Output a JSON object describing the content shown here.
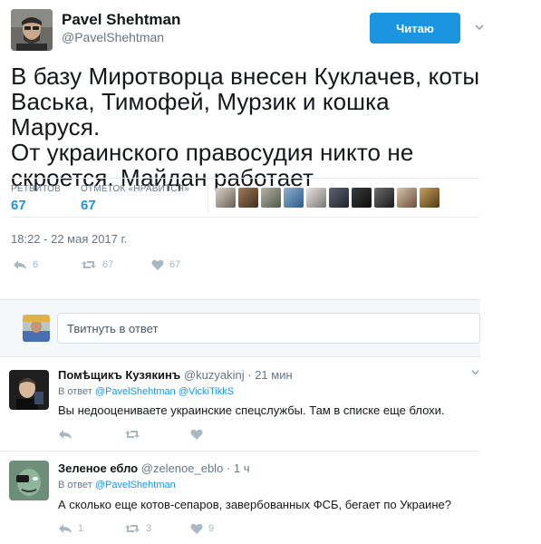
{
  "tweet": {
    "author_name": "Pavel Shehtman",
    "author_handle": "@PavelShehtman",
    "follow_label": "Читаю",
    "text_lines": [
      "В базу Миротворца внесен Куклачев, коты",
      "Васька, Тимофей, Мурзик и кошка Маруся.",
      "От украинского правосудия никто не",
      "скроется. Майдан работает"
    ],
    "retweets_label": "РЕТВИТОВ",
    "retweets_count": "67",
    "likes_label": "ОТМЕТОК «НРАВИТСЯ»",
    "likes_count": "67",
    "timestamp": "18:22 - 22 мая 2017 г.",
    "action_reply_count": "6",
    "action_retweet_count": "67",
    "action_like_count": "67"
  },
  "reply_box": {
    "placeholder": "Твитнуть в ответ"
  },
  "replies": [
    {
      "name": "Помѣщикъ Кузякинъ",
      "handle": "@kuzyakinj",
      "dot": "·",
      "time": "21 мин",
      "in_reply_prefix": "В ответ",
      "mentions": "@PavelShehtman @VickiTikkS",
      "text": "Вы недооцениваете украинские спецслужбы. Там в списке еще блохи.",
      "reply_count": "",
      "retweet_count": "",
      "like_count": ""
    },
    {
      "name": "Зеленое ебло",
      "handle": "@zelenoe_eblo",
      "dot": "·",
      "time": "1 ч",
      "in_reply_prefix": "В ответ",
      "mentions": "@PavelShehtman",
      "text": "А сколько еще котов-сепаров, завербованных ФСБ, бегает по Украине?",
      "reply_count": "1",
      "retweet_count": "3",
      "like_count": "9"
    }
  ],
  "colors": {
    "accent": "#1b95e0",
    "muted": "#657786",
    "icon": "#aab8c2"
  }
}
